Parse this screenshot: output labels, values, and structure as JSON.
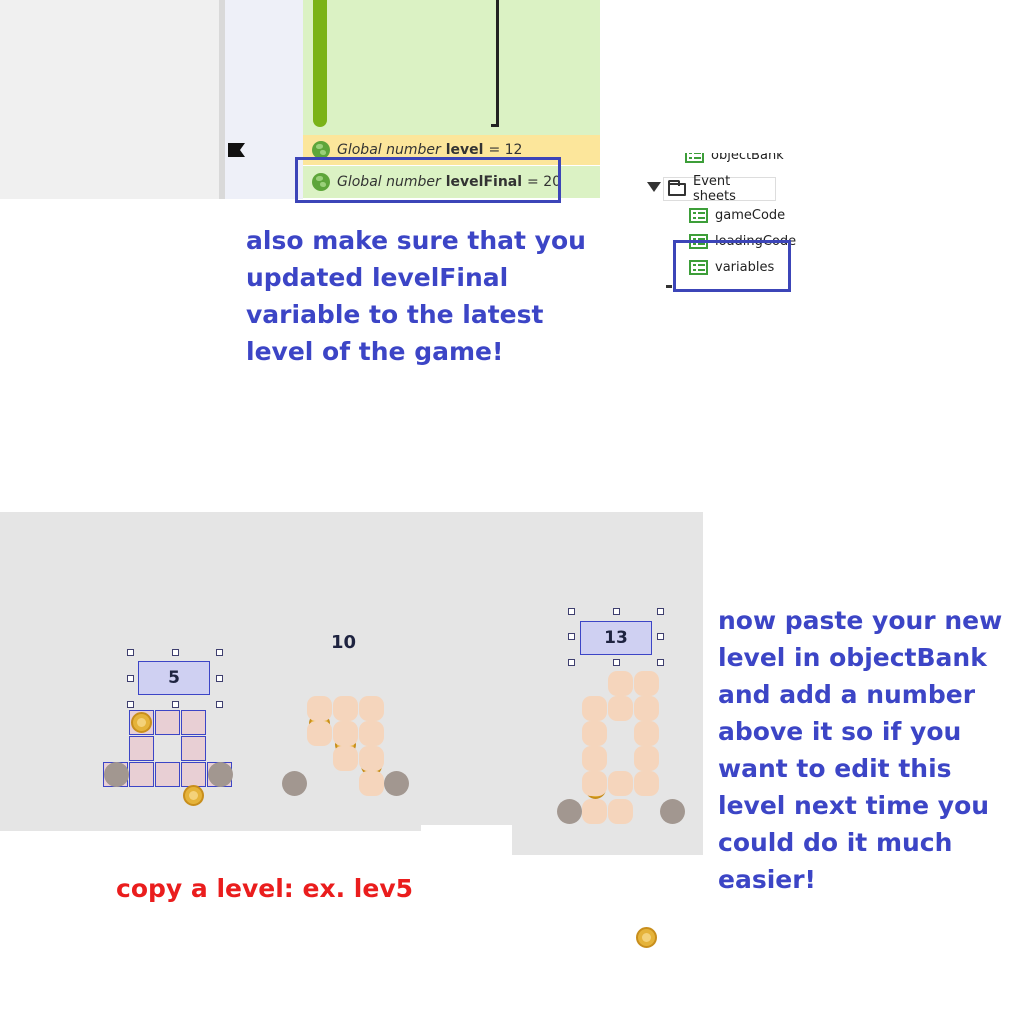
{
  "editor": {
    "variables": [
      {
        "kind": "Global number",
        "name": "level",
        "value": "= 12"
      },
      {
        "kind": "Global number",
        "name": "levelFinal",
        "value": "= 20"
      }
    ],
    "tree": {
      "cut_item": "objectBank",
      "folder": "Event sheets",
      "sheets": [
        "gameCode",
        "loadingCode",
        "variables"
      ]
    }
  },
  "captions": {
    "top": "also make sure that you updated levelFinal variable to the latest level of the game!",
    "right": "now paste your new level in objectBank and add a number above it so if you want to edit this level next time you could do it much easier!",
    "bottom": "copy a level: ex. lev5"
  },
  "game": {
    "level_labels": [
      "5",
      "10",
      "13"
    ]
  },
  "colors": {
    "highlight": "#3c45b8",
    "caption_blue": "#3c45c6",
    "caption_red": "#ea1d1d",
    "variable_bar": "#7ab317",
    "tile": "#f5d5bc",
    "stone": "#a29790",
    "coin": "#e5b33a"
  },
  "icons": [
    "flag-icon",
    "globe-icon",
    "folder-icon",
    "event-sheet-icon",
    "expand-triangle-icon",
    "coin-icon"
  ]
}
